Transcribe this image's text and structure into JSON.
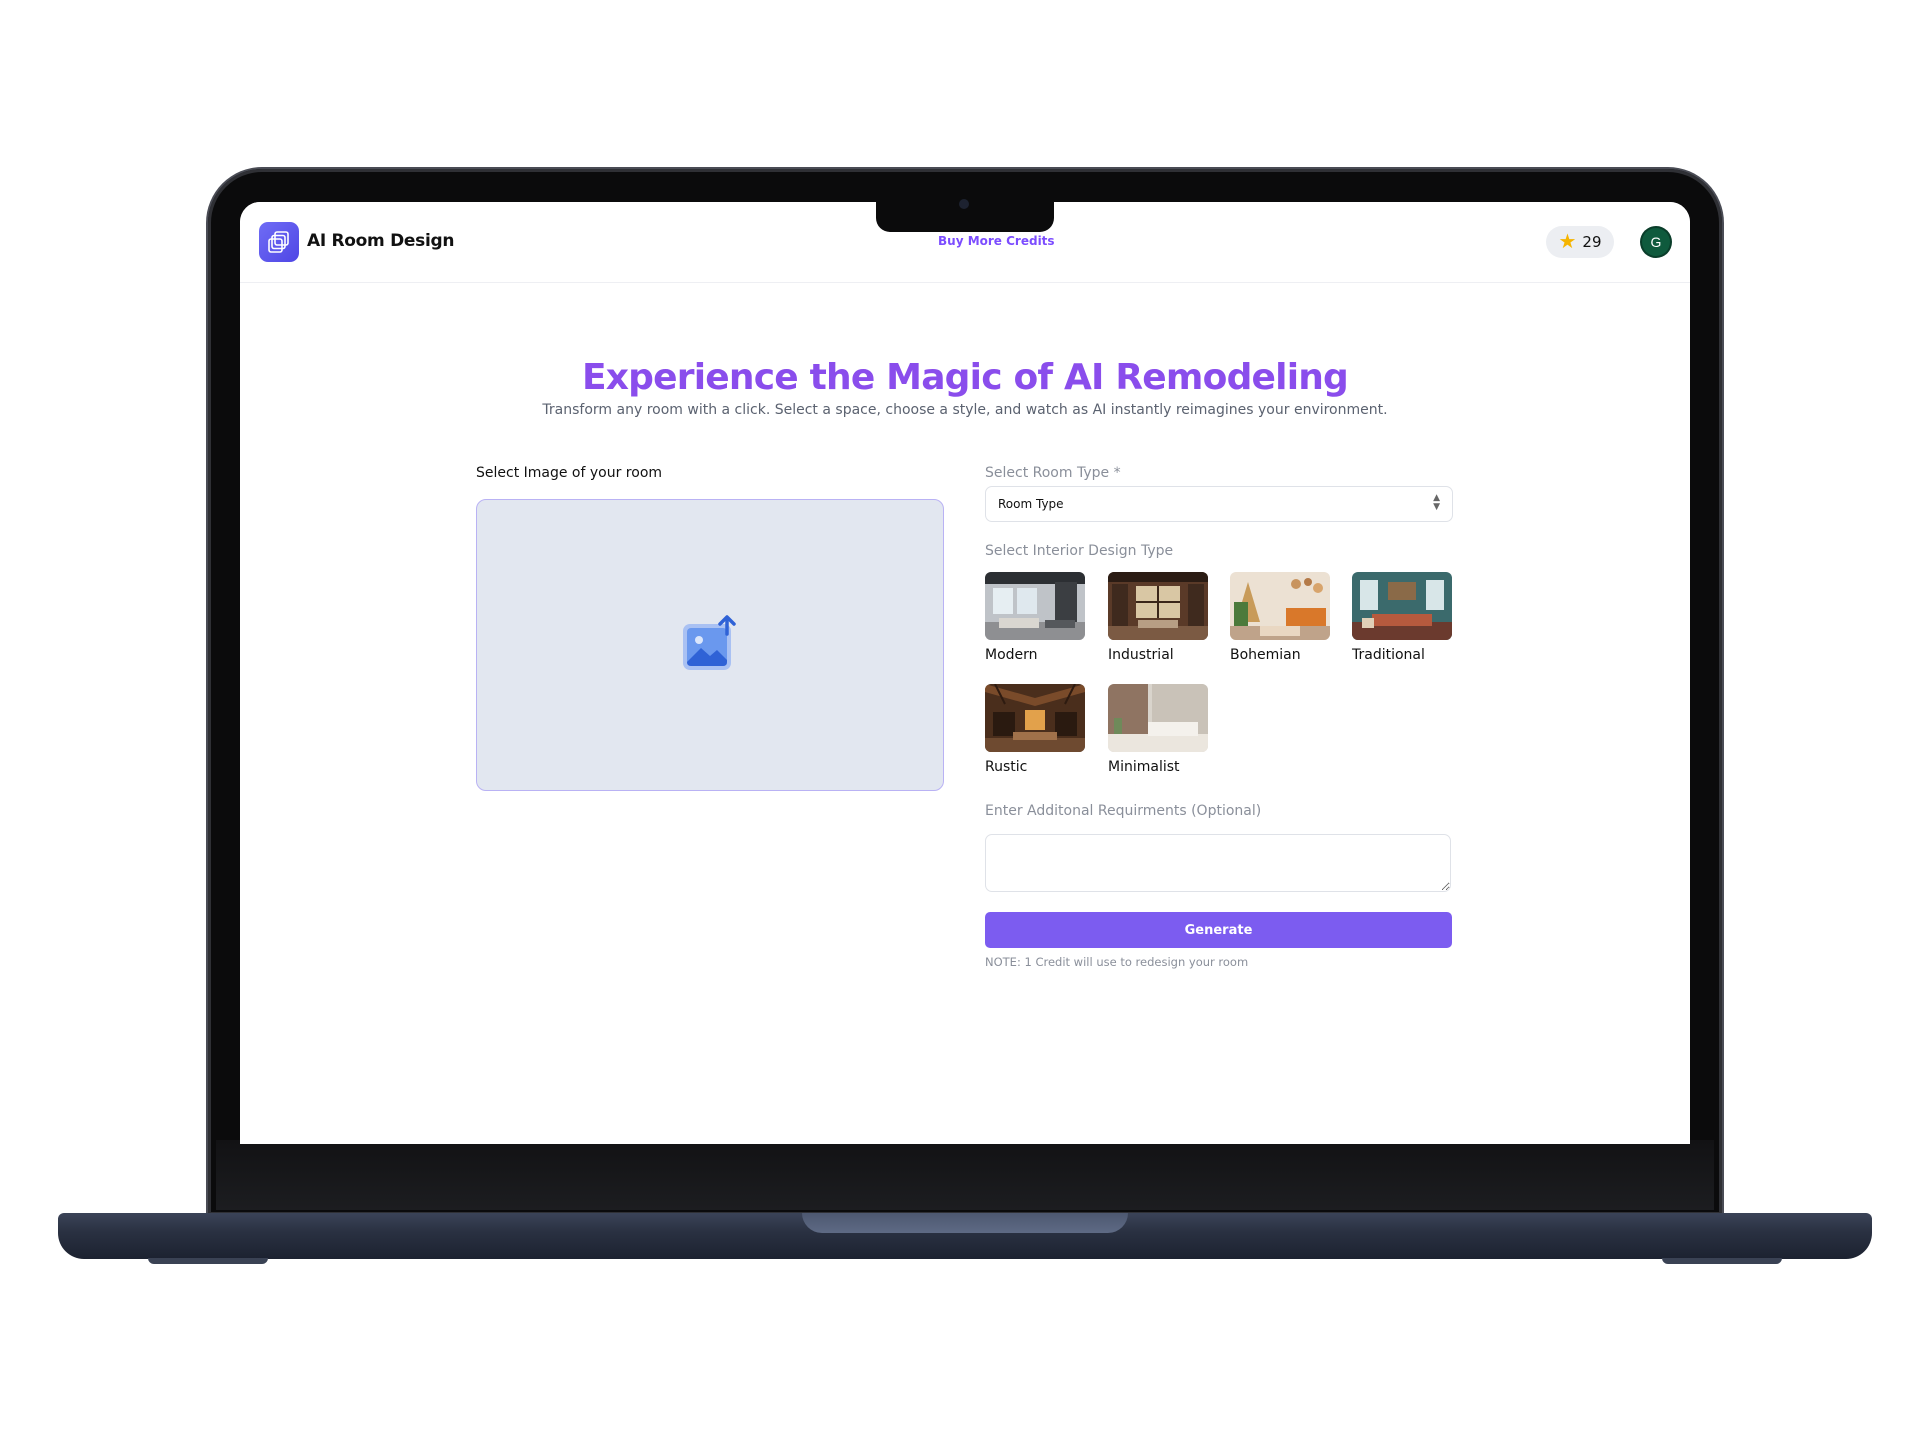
{
  "header": {
    "brand": "AI Room Design",
    "buy_credits_link": "Buy More Credits",
    "credits_count": "29",
    "avatar_initial": "G"
  },
  "hero": {
    "title": "Experience the Magic of AI Remodeling",
    "subtitle": "Transform any room with a click. Select a space, choose a style, and watch as AI instantly reimagines your environment."
  },
  "upload": {
    "label": "Select Image of your room"
  },
  "room_type": {
    "label": "Select Room Type *",
    "selected": "Room Type"
  },
  "design": {
    "label": "Select Interior Design Type",
    "styles": [
      {
        "name": "Modern"
      },
      {
        "name": "Industrial"
      },
      {
        "name": "Bohemian"
      },
      {
        "name": "Traditional"
      },
      {
        "name": "Rustic"
      },
      {
        "name": "Minimalist"
      }
    ]
  },
  "requirements": {
    "label": "Enter Additonal Requirments (Optional)",
    "value": ""
  },
  "generate": {
    "button_label": "Generate",
    "note": "NOTE: 1 Credit will use to redesign your room"
  },
  "colors": {
    "accent": "#7c5cf0",
    "title": "#8a4dec",
    "logo": "#5b57f0",
    "avatar": "#0f5a3d",
    "star": "#f5b400"
  }
}
